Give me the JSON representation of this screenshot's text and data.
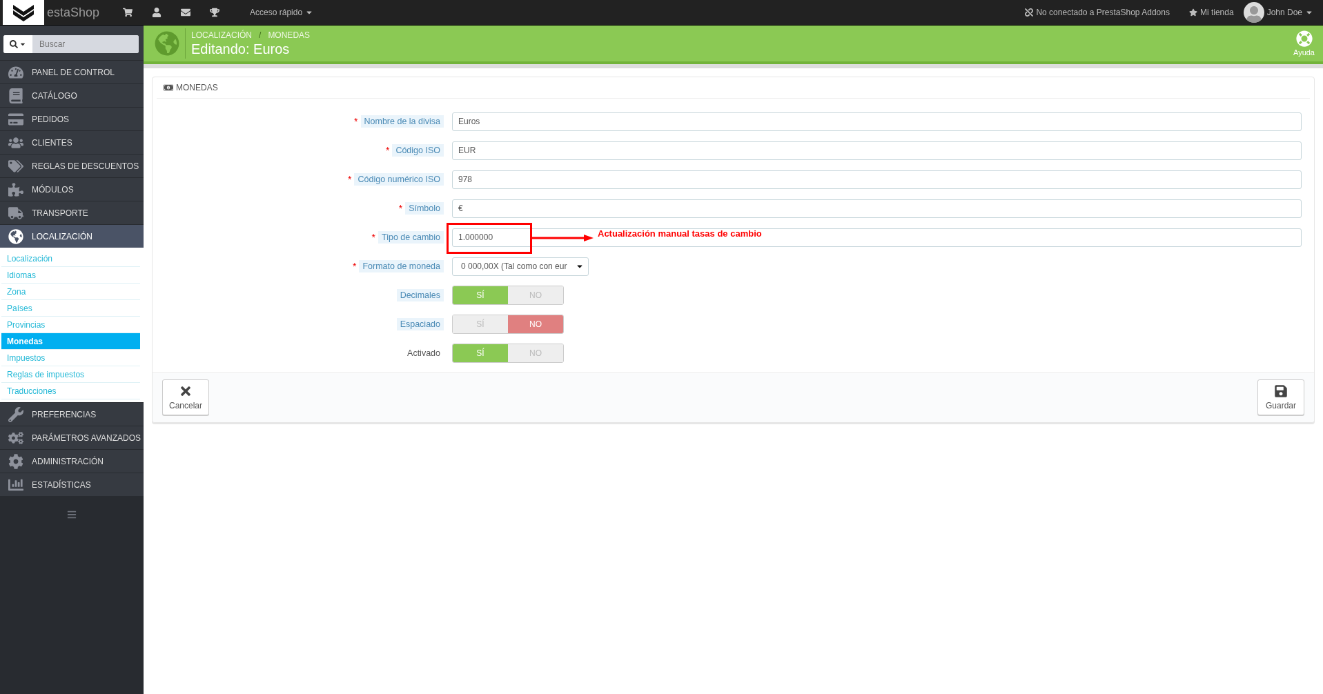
{
  "topbar": {
    "logo_text": "estaShop",
    "quick_access": "Acceso rápido",
    "addons_status": "No conectado a PrestaShop Addons",
    "shop_link": "Mi tienda",
    "user_name": "John Doe"
  },
  "sidebar": {
    "search": {
      "placeholder": "Buscar"
    },
    "items": [
      {
        "label": "PANEL DE CONTROL",
        "selected": false
      },
      {
        "label": "CATÁLOGO",
        "selected": false
      },
      {
        "label": "PEDIDOS",
        "selected": false
      },
      {
        "label": "CLIENTES",
        "selected": false
      },
      {
        "label": "REGLAS DE DESCUENTOS",
        "selected": false
      },
      {
        "label": "MÓDULOS",
        "selected": false
      },
      {
        "label": "TRANSPORTE",
        "selected": false
      },
      {
        "label": "LOCALIZACIÓN",
        "selected": true,
        "expanded": true,
        "children": [
          {
            "label": "Localización",
            "selected": false
          },
          {
            "label": "Idiomas",
            "selected": false
          },
          {
            "label": "Zona",
            "selected": false
          },
          {
            "label": "Países",
            "selected": false
          },
          {
            "label": "Provincias",
            "selected": false
          },
          {
            "label": "Monedas",
            "selected": true
          },
          {
            "label": "Impuestos",
            "selected": false
          },
          {
            "label": "Reglas de impuestos",
            "selected": false
          },
          {
            "label": "Traducciones",
            "selected": false
          }
        ]
      },
      {
        "label": "PREFERENCIAS",
        "selected": false
      },
      {
        "label": "PARÁMETROS AVANZADOS",
        "selected": false
      },
      {
        "label": "ADMINISTRACIÓN",
        "selected": false
      },
      {
        "label": "ESTADÍSTICAS",
        "selected": false
      }
    ]
  },
  "header": {
    "breadcrumb": [
      "LOCALIZACIÓN",
      "MONEDAS"
    ],
    "breadcrumb_separator": "/",
    "title": "Editando: Euros",
    "help": "Ayuda"
  },
  "form": {
    "title": "MONEDAS",
    "required_mark": "*",
    "fields": [
      {
        "kind": "text",
        "label": "Nombre de la divisa",
        "required": true,
        "has_hint": true,
        "value": "Euros"
      },
      {
        "kind": "text",
        "label": "Código ISO",
        "required": true,
        "has_hint": true,
        "value": "EUR"
      },
      {
        "kind": "text",
        "label": "Código numérico ISO",
        "required": true,
        "has_hint": true,
        "value": "978"
      },
      {
        "kind": "text",
        "label": "Símbolo",
        "required": true,
        "has_hint": true,
        "value": "€"
      },
      {
        "kind": "text",
        "label": "Tipo de cambio",
        "required": true,
        "has_hint": true,
        "value": "1.000000",
        "annotation": "Actualización manual tasas de cambio"
      },
      {
        "kind": "select",
        "label": "Formato de moneda",
        "required": true,
        "has_hint": true,
        "value": "0 000,00X (Tal como con eur"
      },
      {
        "kind": "toggle",
        "label": "Decimales",
        "required": false,
        "has_hint": true,
        "options": [
          "SÍ",
          "NO"
        ],
        "on": true
      },
      {
        "kind": "toggle",
        "label": "Espaciado",
        "required": false,
        "has_hint": true,
        "options": [
          "SÍ",
          "NO"
        ],
        "on": false
      },
      {
        "kind": "toggle",
        "label": "Activado",
        "required": false,
        "has_hint": false,
        "options": [
          "SÍ",
          "NO"
        ],
        "on": true
      }
    ],
    "buttons": [
      {
        "kind": "cancel",
        "label": "Cancelar"
      },
      {
        "kind": "save",
        "label": "Guardar"
      }
    ]
  }
}
